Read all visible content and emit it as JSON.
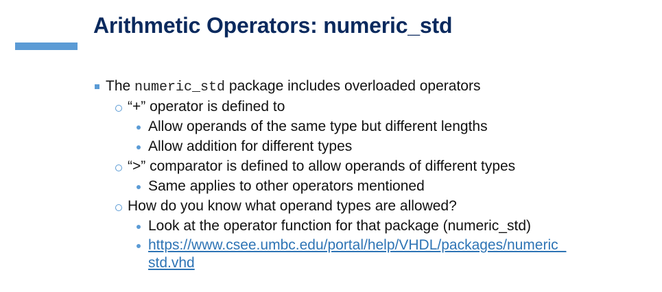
{
  "slide": {
    "title": "Arithmetic Operators: numeric_std",
    "accent_color": "#5b9bd5",
    "title_color": "#0b2a5e",
    "bullets": {
      "b1_pre": "The ",
      "b1_code": "numeric_std",
      "b1_post": " package includes overloaded operators",
      "b1_1": "“+” operator is defined to",
      "b1_1_1": "Allow operands of the same type but different lengths",
      "b1_1_2": "Allow addition for different types",
      "b1_2": "“>” comparator is defined to allow operands of different types",
      "b1_2_1": "Same applies to other operators mentioned",
      "b1_3": "How do you know what operand types are allowed?",
      "b1_3_1": "Look at the operator function for that package (numeric_std)",
      "b1_3_2_line1": "https://www.csee.umbc.edu/portal/help/VHDL/packages/numeric_",
      "b1_3_2_line2": "std.vhd"
    }
  }
}
